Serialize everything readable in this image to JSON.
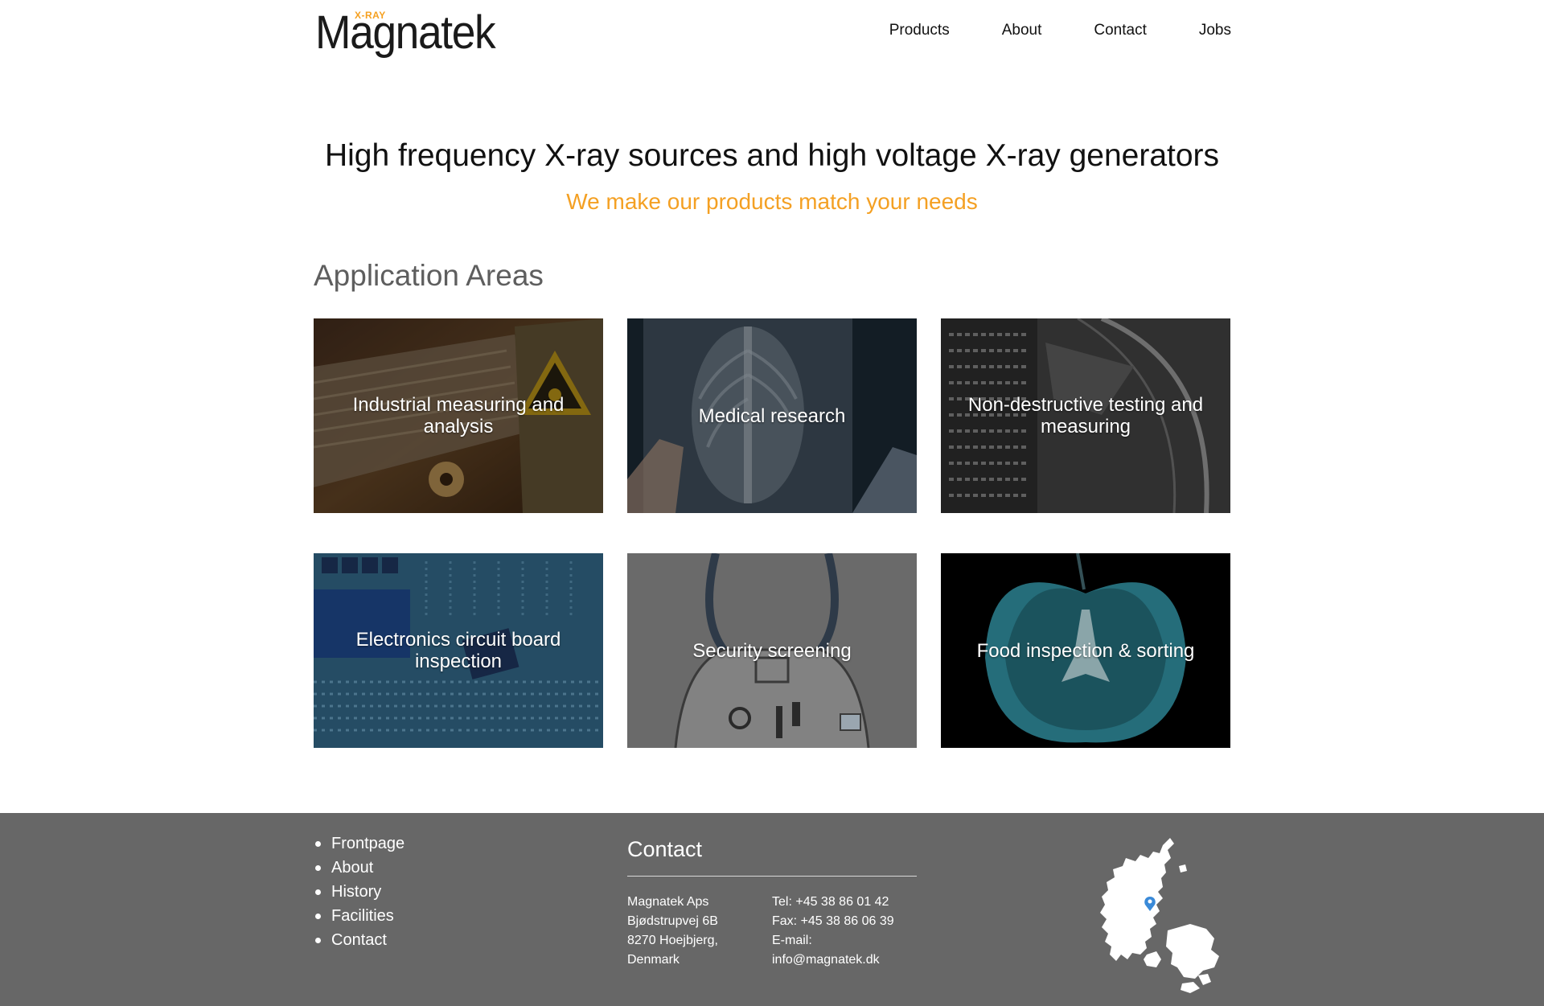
{
  "brand": {
    "name": "Magnatek",
    "tag": "X-RAY"
  },
  "nav": [
    {
      "label": "Products"
    },
    {
      "label": "About"
    },
    {
      "label": "Contact"
    },
    {
      "label": "Jobs"
    }
  ],
  "hero": {
    "title": "High frequency X-ray sources and high voltage X-ray generators",
    "subtitle": "We make our products match your needs"
  },
  "applications": {
    "title": "Application Areas",
    "tiles": [
      {
        "label": "Industrial measuring and analysis"
      },
      {
        "label": "Medical research"
      },
      {
        "label": "Non-destructive testing and measuring"
      },
      {
        "label": "Electronics circuit board inspection"
      },
      {
        "label": "Security screening"
      },
      {
        "label": "Food inspection & sorting"
      }
    ]
  },
  "footer": {
    "links": [
      {
        "label": "Frontpage"
      },
      {
        "label": "About"
      },
      {
        "label": "History"
      },
      {
        "label": "Facilities"
      },
      {
        "label": "Contact"
      }
    ],
    "contact": {
      "title": "Contact",
      "address": [
        "Magnatek Aps",
        "Bjødstrupvej 6B",
        "8270 Hoejbjerg,",
        "Denmark"
      ],
      "phones": [
        "Tel: +45 38 86 01 42",
        "Fax: +45 38 86 06 39",
        "E-mail:",
        "info@magnatek.dk"
      ]
    }
  },
  "colors": {
    "accent": "#f4a023",
    "footer_bg": "#676767",
    "section_title": "#5e5e5e"
  },
  "icons": {
    "map": "denmark-map-icon",
    "pin": "location-pin-icon"
  }
}
